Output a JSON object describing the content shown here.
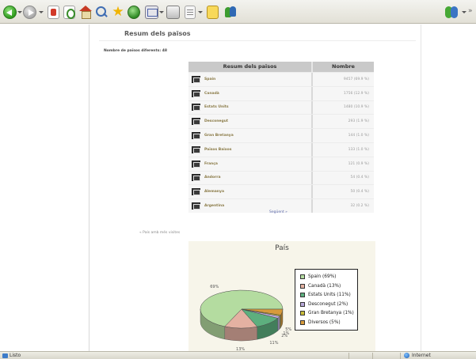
{
  "page": {
    "title": "Resum dels països",
    "country_count_label": "Nombre de països diferents:",
    "country_count_value": "48"
  },
  "table": {
    "headers": {
      "country": "Resum dels països",
      "count": "Nombre"
    },
    "rows": [
      {
        "country": "Spain",
        "count": "9457 (69.9 %)"
      },
      {
        "country": "Canadà",
        "count": "1756 (12.9 %)"
      },
      {
        "country": "Estats Units",
        "count": "1480 (10.9 %)"
      },
      {
        "country": "Desconegut",
        "count": "293 (1.9 %)"
      },
      {
        "country": "Gran Bretanya",
        "count": "144 (1.0 %)"
      },
      {
        "country": "Països Baixos",
        "count": "133 (1.0 %)"
      },
      {
        "country": "França",
        "count": "121 (0.9 %)"
      },
      {
        "country": "Andorra",
        "count": "54 (0.4 %)"
      },
      {
        "country": "Alemanya",
        "count": "50 (0.4 %)"
      },
      {
        "country": "Argentina",
        "count": "32 (0.2 %)"
      }
    ],
    "next_link": "Següent »"
  },
  "links": {
    "more_visits": "« País amb més visites"
  },
  "chart_data": {
    "type": "pie",
    "title": "País",
    "categories": [
      "Spain",
      "Canadà",
      "Estats Units",
      "Desconegut",
      "Gran Bretanya",
      "Diversos"
    ],
    "values": [
      69,
      13,
      11,
      2,
      1,
      5
    ],
    "legend": [
      {
        "label": "Spain (69%)",
        "color": "#b4dca0"
      },
      {
        "label": "Canadà (13%)",
        "color": "#e4b1a2"
      },
      {
        "label": "Estats Units (11%)",
        "color": "#5daf7e"
      },
      {
        "label": "Desconegut (2%)",
        "color": "#b8a9d9"
      },
      {
        "label": "Gran Bretanya (1%)",
        "color": "#c9bc3a"
      },
      {
        "label": "Diversos (5%)",
        "color": "#d79b3b"
      }
    ],
    "slice_labels": [
      "69%",
      "13%",
      "11%",
      "2%",
      "1%",
      "5%"
    ],
    "legend_position": "right",
    "style": "3d"
  },
  "statusbar": {
    "status": "Listo",
    "zone": "Internet"
  },
  "icons": [
    "back-icon",
    "forward-icon",
    "stop-icon",
    "refresh-icon",
    "home-icon",
    "search-icon",
    "favorites-icon",
    "history-icon",
    "mail-icon",
    "print-icon",
    "edit-icon",
    "notes-icon",
    "msn-icon",
    "messenger-icon",
    "flag-icon",
    "internet-zone-icon"
  ]
}
